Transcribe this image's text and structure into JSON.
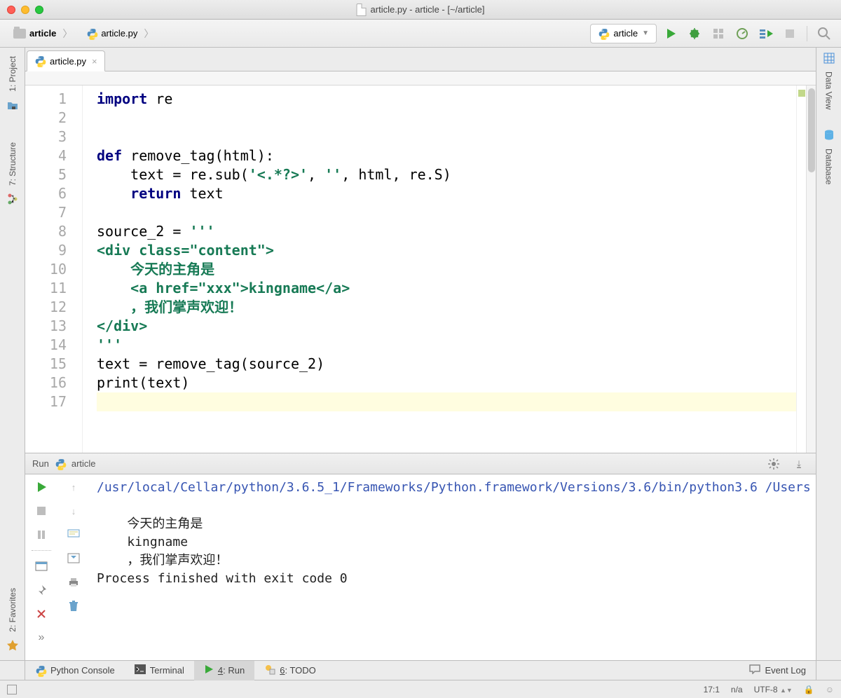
{
  "window": {
    "title": "article.py - article - [~/article]"
  },
  "breadcrumbs": {
    "project": "article",
    "file": "article.py"
  },
  "run_config": {
    "label": "article"
  },
  "tab": {
    "name": "article.py"
  },
  "left_tools": {
    "project": "1: Project",
    "structure": "7: Structure",
    "favorites": "2: Favorites"
  },
  "right_tools": {
    "dataview": "Data View",
    "database": "Database"
  },
  "editor": {
    "gutter_start": 1,
    "gutter_end": 17,
    "lines": [
      [
        {
          "t": "kw",
          "v": "import "
        },
        {
          "t": "p",
          "v": "re"
        }
      ],
      [],
      [],
      [
        {
          "t": "kw",
          "v": "def "
        },
        {
          "t": "p",
          "v": "remove_tag(html):"
        }
      ],
      [
        {
          "t": "p",
          "v": "    text = re.sub("
        },
        {
          "t": "str",
          "v": "'<.*?>'"
        },
        {
          "t": "p",
          "v": ", "
        },
        {
          "t": "str",
          "v": "''"
        },
        {
          "t": "p",
          "v": ", html, re.S)"
        }
      ],
      [
        {
          "t": "p",
          "v": "    "
        },
        {
          "t": "kw",
          "v": "return "
        },
        {
          "t": "p",
          "v": "text"
        }
      ],
      [],
      [
        {
          "t": "p",
          "v": "source_2 = "
        },
        {
          "t": "str",
          "v": "'''"
        }
      ],
      [
        {
          "t": "str",
          "v": "<div class=\"content\">"
        }
      ],
      [
        {
          "t": "str",
          "v": "    今天的主角是"
        }
      ],
      [
        {
          "t": "str",
          "v": "    <a href=\"xxx\">kingname</a>"
        }
      ],
      [
        {
          "t": "str",
          "v": "    ，我们掌声欢迎！"
        }
      ],
      [
        {
          "t": "str",
          "v": "</div>"
        }
      ],
      [
        {
          "t": "str",
          "v": "'''"
        }
      ],
      [
        {
          "t": "p",
          "v": "text = remove_tag(source_2)"
        }
      ],
      [
        {
          "t": "p",
          "v": "print(text)"
        }
      ],
      []
    ]
  },
  "run_panel": {
    "title": "Run",
    "config": "article",
    "command": "/usr/local/Cellar/python/3.6.5_1/Frameworks/Python.framework/Versions/3.6/bin/python3.6 /Users",
    "output": "\n    今天的主角是\n    kingname\n    ，我们掌声欢迎！\n",
    "exit": "Process finished with exit code 0"
  },
  "bottom": {
    "python_console": "Python Console",
    "terminal": "Terminal",
    "run": "4: Run",
    "todo": "6: TODO",
    "event_log": "Event Log"
  },
  "status": {
    "position": "17:1",
    "sep": "n/a",
    "encoding": "UTF-8"
  }
}
